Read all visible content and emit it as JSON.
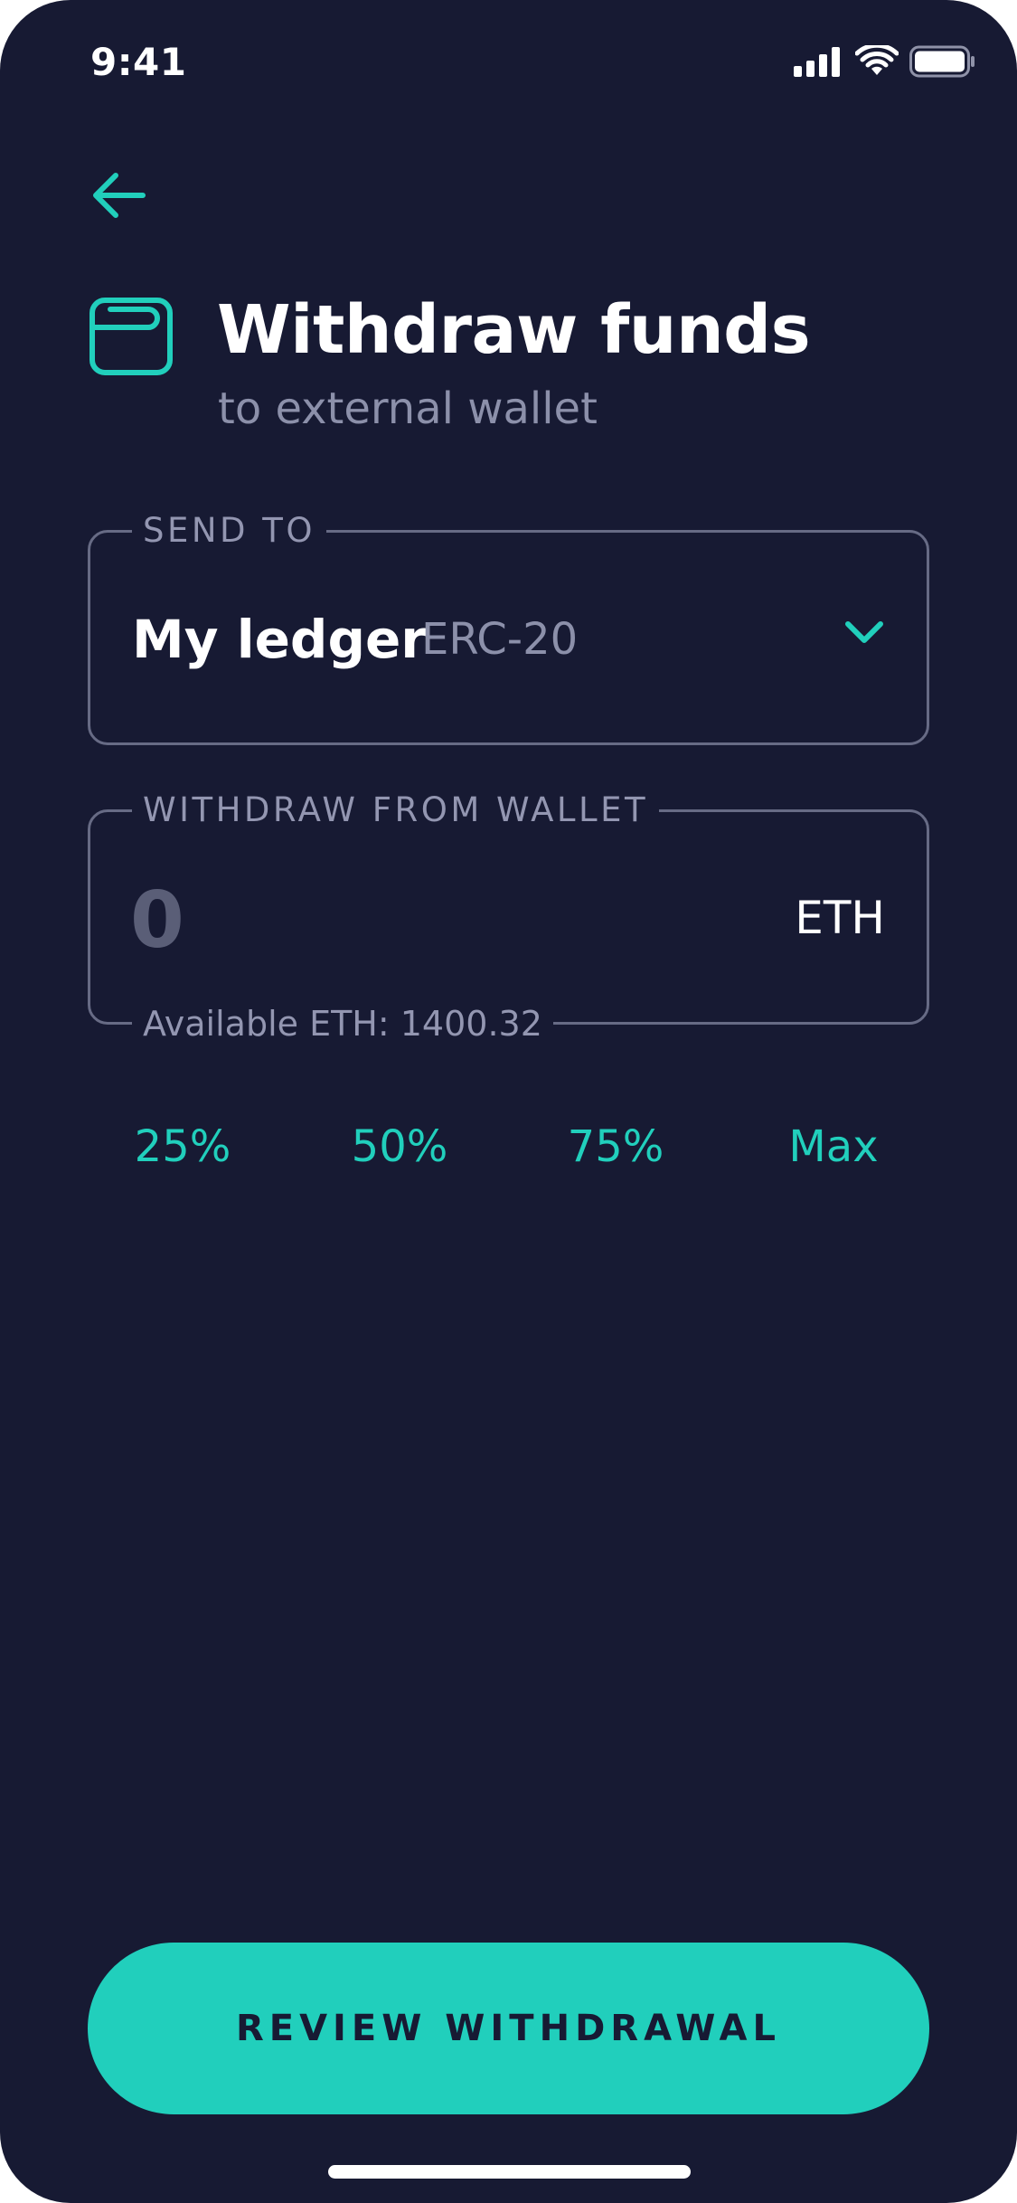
{
  "status_bar": {
    "time": "9:41",
    "icons": [
      "cellular-signal-icon",
      "wifi-icon",
      "battery-icon"
    ]
  },
  "nav": {
    "back_icon": "arrow-left-icon"
  },
  "header": {
    "icon": "wallet-icon",
    "title": "Withdraw funds",
    "subtitle": "to external wallet"
  },
  "send_to": {
    "legend": "SEND TO",
    "wallet_name": "My ledger",
    "network": "ERC-20",
    "dropdown_icon": "chevron-down-icon"
  },
  "withdraw": {
    "legend": "WITHDRAW FROM WALLET",
    "amount_value": "",
    "amount_placeholder": "0",
    "currency": "ETH",
    "available_text": "Available ETH: 1400.32"
  },
  "percent_options": [
    "25%",
    "50%",
    "75%",
    "Max"
  ],
  "review_button": {
    "label": "REVIEW WITHDRAWAL"
  },
  "colors": {
    "background": "#171a33",
    "accent": "#21cfbc",
    "muted_text": "#8c90aa",
    "border": "#676b85"
  }
}
